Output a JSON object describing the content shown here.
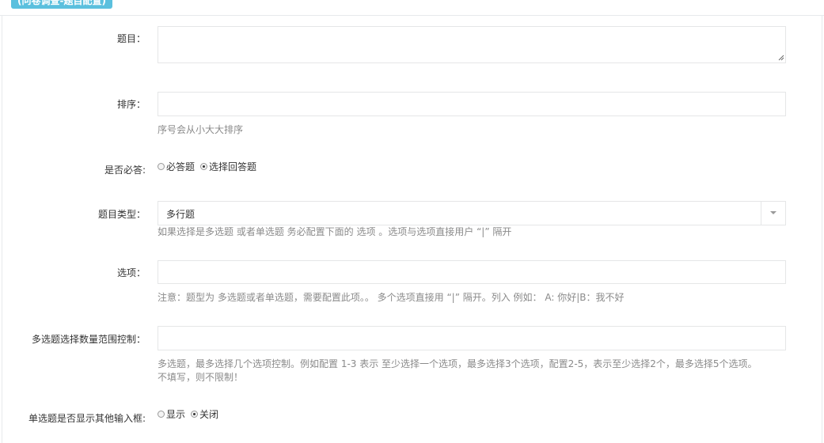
{
  "header": {
    "badge": "(问卷调查-题目配置)"
  },
  "form": {
    "title": {
      "label": "题目：",
      "value": ""
    },
    "sort": {
      "label": "排序：",
      "value": "",
      "help": "序号会从小大大排序"
    },
    "required": {
      "label": "是否必答:",
      "options": [
        {
          "label": "必答题",
          "checked": false
        },
        {
          "label": "选择回答题",
          "checked": true
        }
      ]
    },
    "type": {
      "label": "题目类型：",
      "selected": "多行题",
      "help": "如果选择是多选题 或者单选题 务必配置下面的 选项 。选项与选项直接用户  “|”  隔开"
    },
    "options": {
      "label": "选项：",
      "value": "",
      "help": "注意：题型为 多选题或者单选题，需要配置此项。。 多个选项直接用 “|” 隔开。列入 例如： A: 你好|B：我不好"
    },
    "range": {
      "label": "多选题选择数量范围控制：",
      "value": "",
      "help_line1": "多选题，最多选择几个选项控制。例如配置 1-3 表示 至少选择一个选项，最多选择3个选项，配置2-5，表示至少选择2个，最多选择5个选项。",
      "help_line2": "不填写，则不限制！"
    },
    "other_input": {
      "label": "单选题是否显示其他输入框:",
      "options": [
        {
          "label": "显示",
          "checked": false
        },
        {
          "label": "关闭",
          "checked": true
        }
      ]
    }
  }
}
